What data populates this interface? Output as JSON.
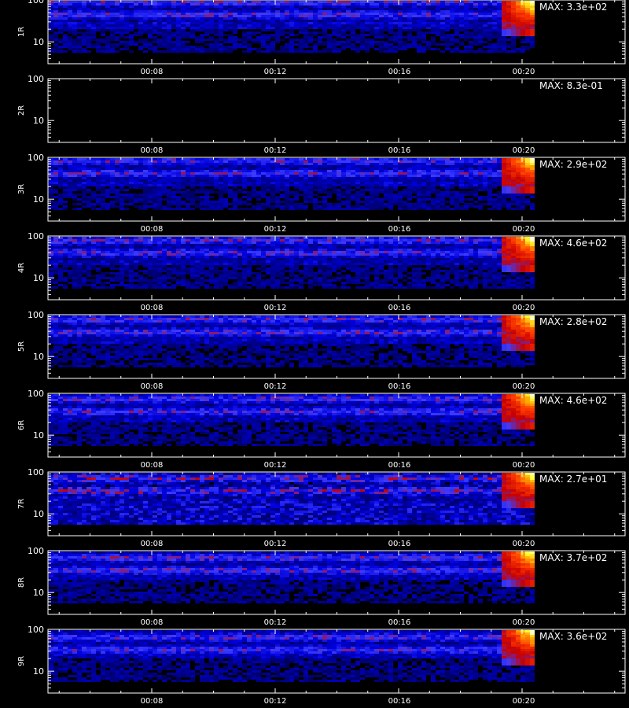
{
  "chart_data": {
    "type": "heatmap",
    "y_scale": "log",
    "ylim": [
      3,
      100
    ],
    "y_ticks": [
      "100",
      "10"
    ],
    "x_ticks": [
      "00:08",
      "00:12",
      "00:16",
      "00:20"
    ],
    "colormap": [
      "#000000",
      "#0000c0",
      "#3a3aff",
      "#c00000",
      "#ff3300",
      "#ff9900",
      "#ffff33",
      "#ffffcc"
    ],
    "panels": [
      {
        "label": "1R",
        "max_label": "MAX: 3.3e+02",
        "max_value": 330,
        "active": true
      },
      {
        "label": "2R",
        "max_label": "MAX: 8.3e-01",
        "max_value": 0.83,
        "active": false
      },
      {
        "label": "3R",
        "max_label": "MAX: 2.9e+02",
        "max_value": 290,
        "active": true
      },
      {
        "label": "4R",
        "max_label": "MAX: 4.6e+02",
        "max_value": 460,
        "active": true
      },
      {
        "label": "5R",
        "max_label": "MAX: 2.8e+02",
        "max_value": 280,
        "active": true
      },
      {
        "label": "6R",
        "max_label": "MAX: 4.6e+02",
        "max_value": 460,
        "active": true
      },
      {
        "label": "7R",
        "max_label": "MAX: 2.7e+01",
        "max_value": 27,
        "active": true
      },
      {
        "label": "8R",
        "max_label": "MAX: 3.7e+02",
        "max_value": 370,
        "active": true
      },
      {
        "label": "9R",
        "max_label": "MAX: 3.6e+02",
        "max_value": 360,
        "active": true
      }
    ]
  }
}
